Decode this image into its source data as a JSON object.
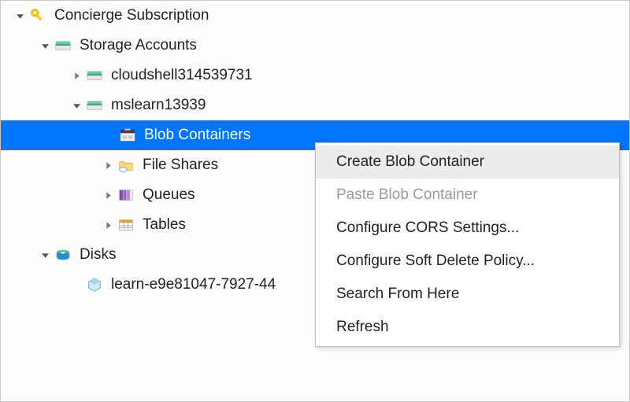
{
  "tree": {
    "subscription": "Concierge Subscription",
    "storage_accounts": "Storage Accounts",
    "sa1": "cloudshell314539731",
    "sa2": "mslearn13939",
    "blob": "Blob Containers",
    "fileshares": "File Shares",
    "queues": "Queues",
    "tables": "Tables",
    "disks": "Disks",
    "disk1": "learn-e9e81047-7927-44"
  },
  "menu": {
    "create": "Create Blob Container",
    "paste": "Paste Blob Container",
    "cors": "Configure CORS Settings...",
    "softdelete": "Configure Soft Delete Policy...",
    "search": "Search From Here",
    "refresh": "Refresh"
  }
}
